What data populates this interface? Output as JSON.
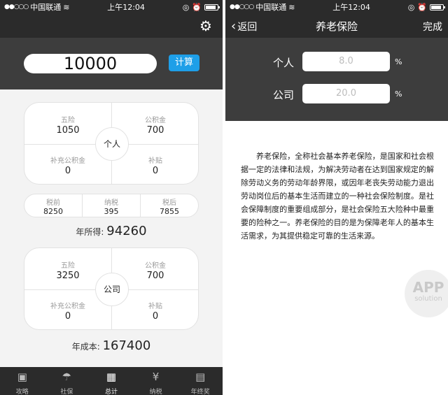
{
  "status_bar": {
    "carrier": "中国联通",
    "time": "上午12:04"
  },
  "left": {
    "amount": "10000",
    "calc_label": "计算",
    "personal": {
      "center": "个人",
      "five_insurances": {
        "label": "五险",
        "value": "1050"
      },
      "housing_fund": {
        "label": "公积金",
        "value": "700"
      },
      "supplementary_fund": {
        "label": "补充公积金",
        "value": "0"
      },
      "allowance": {
        "label": "补贴",
        "value": "0"
      }
    },
    "tax": {
      "pre_tax": {
        "label": "税前",
        "value": "8250"
      },
      "tax": {
        "label": "纳税",
        "value": "395"
      },
      "after_tax": {
        "label": "税后",
        "value": "7855"
      }
    },
    "annual_income": {
      "label": "年所得:",
      "value": "94260"
    },
    "company": {
      "center": "公司",
      "five_insurances": {
        "label": "五险",
        "value": "3250"
      },
      "housing_fund": {
        "label": "公积金",
        "value": "700"
      },
      "supplementary_fund": {
        "label": "补充公积金",
        "value": "0"
      },
      "allowance": {
        "label": "补贴",
        "value": "0"
      }
    },
    "annual_cost": {
      "label": "年成本:",
      "value": "167400"
    },
    "tabs": [
      {
        "label": "攻略",
        "icon": "book-icon"
      },
      {
        "label": "社保",
        "icon": "umbrella-icon"
      },
      {
        "label": "总计",
        "icon": "grid-icon",
        "active": true
      },
      {
        "label": "纳税",
        "icon": "yen-icon"
      },
      {
        "label": "年终奖",
        "icon": "calendar-icon"
      }
    ]
  },
  "right": {
    "back_label": "返回",
    "title": "养老保险",
    "done_label": "完成",
    "personal": {
      "label": "个人",
      "value": "8.0",
      "unit": "%"
    },
    "company": {
      "label": "公司",
      "value": "20.0",
      "unit": "%"
    },
    "description": "养老保险，全称社会基本养老保险，是国家和社会根据一定的法律和法规，为解决劳动者在达到国家规定的解除劳动义务的劳动年龄界限，或因年老丧失劳动能力退出劳动岗位后的基本生活而建立的一种社会保险制度。是社会保障制度的重要组成部分，是社会保险五大险种中最重要的险种之一。养老保险的目的是为保障老年人的基本生活需求，为其提供稳定可靠的生活来源。",
    "watermark_top": "APP",
    "watermark_bottom": "solution"
  }
}
